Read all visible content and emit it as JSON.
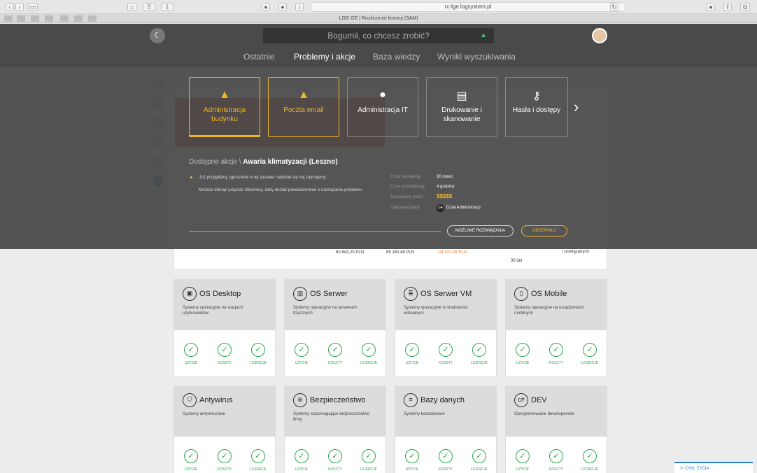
{
  "browser": {
    "url": "rc-lge.logsystem.pl",
    "tab_title": "LOG GE | Rozliczenie licencji (SAM)"
  },
  "header": {
    "search_placeholder": "Bogumił, co chcesz zrobić?"
  },
  "nav": {
    "tabs": [
      "Ostatnie",
      "Problemy i akcje",
      "Baza wiedzy",
      "Wyniki wyszukiwania"
    ],
    "active": "Problemy i akcje"
  },
  "categories": [
    {
      "label": "Administracja budynku",
      "icon": "warning-icon"
    },
    {
      "label": "Poczta email",
      "icon": "warning-icon"
    },
    {
      "label": "Administracja IT",
      "icon": "user-icon"
    },
    {
      "label": "Drukowanie i skanowanie",
      "icon": "printer-icon"
    },
    {
      "label": "Hasła i dostępy",
      "icon": "keys-icon"
    }
  ],
  "actions": {
    "prefix": "Dostępne akcje \\",
    "title": "Awaria klimatyzacji (Leszno)",
    "msg1": "Już przyjęliśmy zgłoszenie w tej sprawie i właśnie się nią zajmujemy.",
    "msg2": "Możesz kliknąć przycisk Obserwuj, żeby dostać powiadomienie o rozwiązaniu problemu",
    "kv": [
      {
        "k": "Czas na reakcję",
        "v": "30 minut"
      },
      {
        "k": "Czas na realizację",
        "v": "4 godziny"
      },
      {
        "k": "Szacowany koszt",
        "v": "$$$$$"
      },
      {
        "k": "Odpowiedzialny",
        "v": "Dział Administracji"
      }
    ],
    "resp_badge": "DA",
    "btn_solutions": "MOŻLIWE ROZWIĄZANIA",
    "btn_watch": "OBSERWUJ"
  },
  "under": {
    "v1": "60 843,20 PLN",
    "v2": "85 180,48 PLN",
    "v3": "-24 337,28 PLN",
    "v4": "30 dni",
    "v5": "i powiązanych"
  },
  "tiles": [
    {
      "title": "OS Desktop",
      "desc": "Systemy operacyjne na stacjach użytkowników",
      "icon": "desktop-icon"
    },
    {
      "title": "OS Serwer",
      "desc": "Systemy operacyjne na serwerach fizycznych",
      "icon": "server-icon"
    },
    {
      "title": "OS Serwer VM",
      "desc": "Systemy operacyjne w środowisku wirtualnym",
      "icon": "server-vm-icon"
    },
    {
      "title": "OS Mobile",
      "desc": "Systemy operacyjne na urządzeniach mobilnych",
      "icon": "mobile-icon"
    },
    {
      "title": "Antywirus",
      "desc": "Systemy antywirusowe",
      "icon": "shield-icon"
    },
    {
      "title": "Bezpieczeństwo",
      "desc": "Systemy wspomagające bezpieczeństwo firmy",
      "icon": "lock-icon"
    },
    {
      "title": "Bazy danych",
      "desc": "Systemy bazodanowe",
      "icon": "database-icon"
    },
    {
      "title": "DEV",
      "desc": "Oprogramowanie deweloperskie",
      "icon": "code-icon"
    }
  ],
  "checks": [
    "UŻYCIE",
    "KOSZTY",
    "LICENCJE"
  ],
  "cykl": "CYKL ŻYCIA"
}
